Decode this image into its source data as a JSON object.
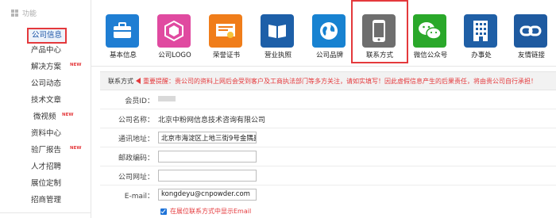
{
  "sidebar": {
    "header": "功能",
    "items": [
      {
        "label": "公司信息",
        "new": false,
        "active": true
      },
      {
        "label": "产品中心",
        "new": false
      },
      {
        "label": "解决方案",
        "new": true
      },
      {
        "label": "公司动态",
        "new": false
      },
      {
        "label": "技术文章",
        "new": false
      },
      {
        "label": "微视频",
        "new": true
      },
      {
        "label": "资料中心",
        "new": false
      },
      {
        "label": "验厂报告",
        "new": true
      },
      {
        "label": "人才招聘",
        "new": false
      },
      {
        "label": "展位定制",
        "new": false
      },
      {
        "label": "招商管理",
        "new": false
      }
    ],
    "new_badge": "NEW"
  },
  "iconbar": {
    "tiles": [
      {
        "label": "基本信息",
        "color": "#1f7ed3",
        "icon": "briefcase-icon"
      },
      {
        "label": "公司LOGO",
        "color": "#e04aa0",
        "icon": "logo-icon"
      },
      {
        "label": "荣誉证书",
        "color": "#f07d1a",
        "icon": "certificate-icon"
      },
      {
        "label": "营业执照",
        "color": "#1d5fa8",
        "icon": "license-book-icon"
      },
      {
        "label": "公司品牌",
        "color": "#1782d1",
        "icon": "globe-icon"
      },
      {
        "label": "联系方式",
        "color": "#6e6e6e",
        "icon": "phone-icon",
        "selected": true
      },
      {
        "label": "微信公众号",
        "color": "#2aa82a",
        "icon": "wechat-icon"
      },
      {
        "label": "办事处",
        "color": "#1f5fa6",
        "icon": "office-building-icon"
      },
      {
        "label": "友情链接",
        "color": "#1e5aa0",
        "icon": "link-icon"
      }
    ]
  },
  "form": {
    "notice_head": "联系方式",
    "notice_warn": "重要提醒：贵公司的资料上网后会受到客户及工商执法部门等多方关注，请如实填写！因此虚假信息产生的后果责任，将由贵公司自行承担！",
    "member_id_label": "会员ID：",
    "company_label": "公司名称：",
    "company_value": "北京中粉网信息技术咨询有限公司",
    "address_label": "通讯地址：",
    "address_value": "北京市海淀区上地三街9号金隅嘉华",
    "zip_label": "邮政编码：",
    "zip_value": "",
    "website_label": "公司网址：",
    "website_value": "",
    "email_label": "E-mail：",
    "email_value": "kongdeyu@cnpowder.com",
    "show_email_label": "在展位联系方式中显示Email",
    "show_email_checked": true
  }
}
